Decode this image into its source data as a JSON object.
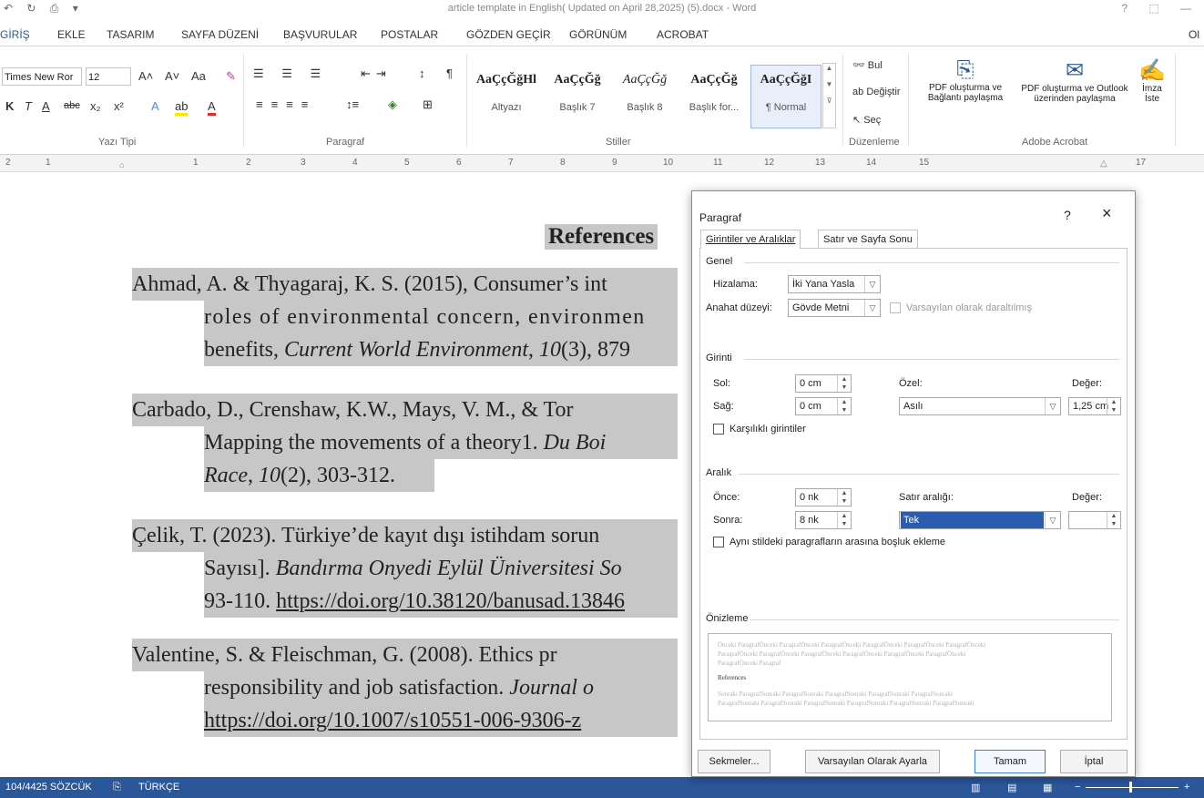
{
  "window": {
    "title": "article template in English( Updated on April 28,2025) (5).docx - Word",
    "quick_access": "↶ ↻ ⎙ ▾",
    "controls": "?  ⬚  —"
  },
  "ribbon_tabs": [
    "GİRİŞ",
    "EKLE",
    "TASARIM",
    "SAYFA DÜZENİ",
    "BAŞVURULAR",
    "POSTALAR",
    "GÖZDEN GEÇİR",
    "GÖRÜNÜM",
    "ACROBAT",
    "Ol"
  ],
  "font_group": {
    "font_name": "Times New Ror",
    "font_size": "12",
    "grow": "A˄",
    "shrink": "A˅",
    "case": "Aa",
    "clear": "✎",
    "bold": "K",
    "italic": "T",
    "underline": "A",
    "strike": "abc",
    "subscript": "x₂",
    "superscript": "x²",
    "text_effects": "A",
    "highlight": "ab",
    "font_color": "A",
    "label": "Yazı Tipi"
  },
  "paragraph_group": {
    "label": "Paragraf"
  },
  "styles_group": {
    "label": "Stiller",
    "styles": [
      {
        "sample": "AaÇçĞğHl",
        "name": "Altyazı"
      },
      {
        "sample": "AaÇçĞğ",
        "name": "Başlık 7"
      },
      {
        "sample": "AaÇçĞğ",
        "name": "Başlık 8"
      },
      {
        "sample": "AaÇçĞğ",
        "name": "Başlık for..."
      },
      {
        "sample": "AaÇçĞğI",
        "name": "¶ Normal"
      }
    ]
  },
  "editing_group": {
    "label": "Düzenleme",
    "find": "Bul",
    "replace": "Değiştir",
    "select": "Seç"
  },
  "acrobat_group": {
    "label": "Adobe Acrobat",
    "btn1_line1": "PDF oluşturma ve",
    "btn1_line2": "Bağlantı paylaşma",
    "btn2_line1": "PDF oluşturma ve Outlook",
    "btn2_line2": "üzerinden paylaşma",
    "btn3_line1": "İmza",
    "btn3_line2": "İste"
  },
  "ruler": [
    "2",
    "1",
    "1",
    "2",
    "3",
    "4",
    "5",
    "6",
    "7",
    "8",
    "9",
    "10",
    "11",
    "12",
    "13",
    "14",
    "15",
    "17"
  ],
  "document": {
    "heading": "References",
    "ref1": {
      "l1": "Ahmad, A. & Thyagaraj, K. S. (2015), Consumer’s int",
      "l2": "roles of environmental concern, environmen",
      "l3a": "benefits, ",
      "l3i": "Current World Environment",
      "l3b": ", ",
      "l3v": "10",
      "l3c": "(3), 879"
    },
    "ref2": {
      "l1": "Carbado, D., Crenshaw, K.W., Mays, V. M., & Tor",
      "l2a": "Mapping the movements of a theory1. ",
      "l2i": "Du Boi",
      "l3i": "Race",
      "l3a": ", ",
      "l3v": "10",
      "l3b": "(2), 303-312."
    },
    "ref3": {
      "l1": "Çelik, T. (2023). Türkiye’de kayıt dışı istihdam sorun",
      "l2a": "Sayısı]. ",
      "l2i": "Bandırma Onyedi Eylül Üniversitesi So",
      "l3a": "93-110. ",
      "l3u": "https://doi.org/10.38120/banusad.13846"
    },
    "ref4": {
      "l1": "Valentine, S. & Fleischman, G. (2008). Ethics pr",
      "l2a": "responsibility and job satisfaction. ",
      "l2i": "Journal o",
      "l3u": "https://doi.org/10.1007/s10551-006-9306-z"
    }
  },
  "status": {
    "words": "104/4425 SÖZCÜK",
    "language": "TÜRKÇE",
    "zoom_minus": "−",
    "zoom_plus": "+"
  },
  "dialog": {
    "title": "Paragraf",
    "help": "?",
    "close": "×",
    "tab1": "Girintiler ve Aralıklar",
    "tab2": "Satır ve Sayfa Sonu",
    "general": "Genel",
    "alignment_label": "Hizalama:",
    "alignment_value": "İki Yana Yasla",
    "outline_label": "Anahat düzeyi:",
    "outline_value": "Gövde Metni",
    "collapsed_label": "Varsayılan olarak daraltılmış",
    "indent": "Girinti",
    "left_label": "Sol:",
    "left_value": "0 cm",
    "right_label": "Sağ:",
    "right_value": "0 cm",
    "special_label": "Özel:",
    "special_value": "Asılı",
    "by_label": "Değer:",
    "by_value": "1,25 cm",
    "mirror_label": "Karşılıklı girintiler",
    "spacing": "Aralık",
    "before_label": "Önce:",
    "before_value": "0 nk",
    "after_label": "Sonra:",
    "after_value": "8 nk",
    "line_spacing_label": "Satır aralığı:",
    "line_spacing_value": "Tek",
    "at_label": "Değer:",
    "at_value": "",
    "no_space_label": "Aynı stildeki paragrafların arasına boşluk ekleme",
    "preview": "Önizleme",
    "preview_prev1": "Önceki  ParagrafÖnceki  ParagrafÖnceki  ParagrafÖnceki  ParagrafÖnceki  ParagrafÖnceki  ParagrafÖnceki",
    "preview_prev2": "ParagrafÖnceki  ParagrafÖnceki  ParagrafÖnceki  ParagrafÖnceki  ParagrafÖnceki  ParagrafÖnceki",
    "preview_prev3": "ParagrafÖnceki Paragraf",
    "preview_text": "References",
    "preview_next1": "Sonraki  ParagrafSonraki  ParagrafSonraki  ParagrafSonraki  ParagrafSonraki  ParagrafSonraki",
    "preview_next2": "ParagrafSonraki  ParagrafSonraki  ParagrafSonraki  ParagrafSonraki  ParagrafSonraki  ParagrafSonraki",
    "tabs_button": "Sekmeler...",
    "default_button": "Varsayılan Olarak Ayarla",
    "ok_button": "Tamam",
    "cancel_button": "İptal"
  },
  "colors": {
    "accent": "#2b579a",
    "highlight": "#c7c7c7",
    "selection": "#2a5db0"
  }
}
